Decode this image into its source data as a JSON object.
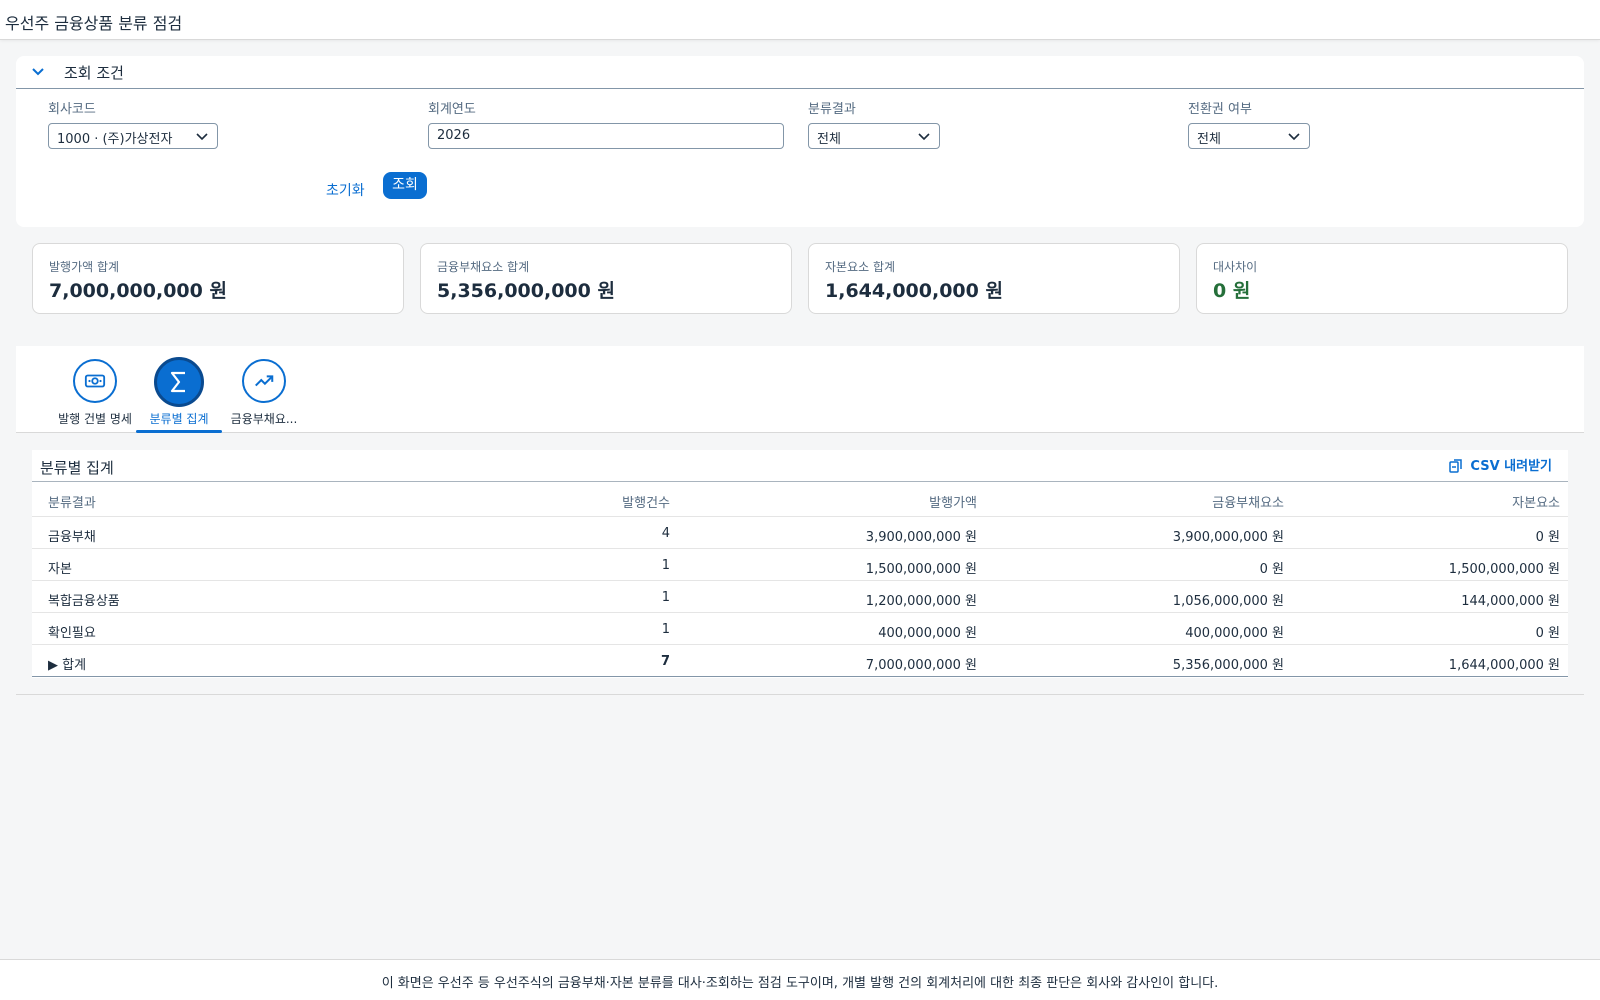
{
  "app": {
    "title": "우선주 금융상품 분류 점검"
  },
  "filter": {
    "header": "조회 조건",
    "company_label": "회사코드",
    "company_value": "1000 · (주)가상전자",
    "year_label": "회계연도",
    "year_value": "2026",
    "result_label": "분류결과",
    "result_value": "전체",
    "conversion_label": "전환권 여부",
    "conversion_value": "전체",
    "reset_label": "초기화",
    "go_label": "조회"
  },
  "kpis": [
    {
      "label": "발행가액 합계",
      "value": "7,000,000,000 원"
    },
    {
      "label": "금융부채요소 합계",
      "value": "5,356,000,000 원"
    },
    {
      "label": "자본요소 합계",
      "value": "1,644,000,000 원"
    },
    {
      "label": "대사차이",
      "value": "0 원",
      "status_color": "#256f3a"
    }
  ],
  "tabs": [
    {
      "label": "발행 건별 명세",
      "icon": "banknote-icon"
    },
    {
      "label": "분류별 집계",
      "icon": "sigma-icon",
      "active": true
    },
    {
      "label": "금융부채요...",
      "icon": "trend-up-icon"
    }
  ],
  "table": {
    "title": "분류별 집계",
    "csv_label": "CSV 내려받기",
    "columns": [
      "분류결과",
      "발행건수",
      "발행가액",
      "금융부채요소",
      "자본요소"
    ],
    "rows": [
      [
        "금융부채",
        "4",
        "3,900,000,000 원",
        "3,900,000,000 원",
        "0 원"
      ],
      [
        "자본",
        "1",
        "1,500,000,000 원",
        "0 원",
        "1,500,000,000 원"
      ],
      [
        "복합금융상품",
        "1",
        "1,200,000,000 원",
        "1,056,000,000 원",
        "144,000,000 원"
      ],
      [
        "확인필요",
        "1",
        "400,000,000 원",
        "400,000,000 원",
        "0 원"
      ]
    ],
    "total": [
      "▶ 합계",
      "7",
      "7,000,000,000 원",
      "5,356,000,000 원",
      "1,644,000,000 원"
    ]
  },
  "footer": {
    "text": "이 화면은 우선주 등 우선주식의 금융부채·자본 분류를 대사·조회하는 점검 도구이며, 개별 발행 건의 회계처리에 대한 최종 판단은 회사와 감사인이 합니다."
  },
  "colors": {
    "accent": "#0a6ed1",
    "positive": "#256f3a"
  }
}
